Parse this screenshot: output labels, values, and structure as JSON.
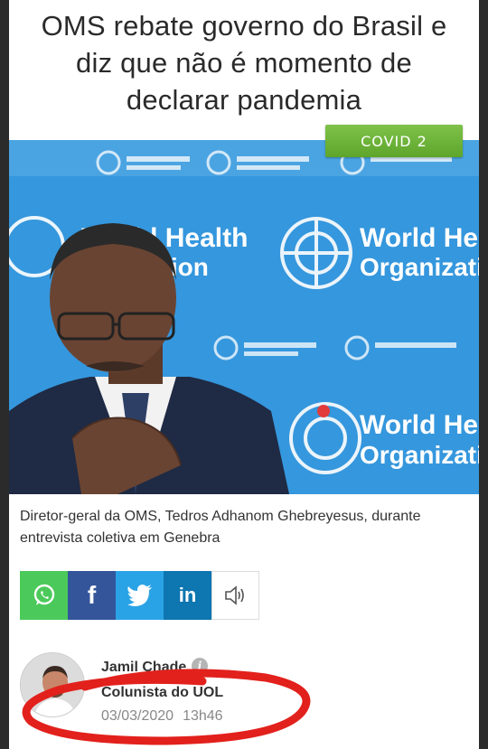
{
  "article": {
    "headline_lines": [
      "OMS rebate governo do Brasil e",
      "diz que não é momento de",
      "declarar pandemia"
    ],
    "tag": "COVID 2",
    "photo_backdrop_text": [
      "World Health",
      "Organization"
    ],
    "caption": "Diretor-geral da OMS, Tedros Adhanom Ghebreyesus, durante entrevista coletiva em Genebra"
  },
  "share": {
    "buttons": [
      {
        "name": "whatsapp",
        "icon": "whatsapp-icon"
      },
      {
        "name": "facebook",
        "icon": "facebook-icon",
        "glyph": "f"
      },
      {
        "name": "twitter",
        "icon": "twitter-icon"
      },
      {
        "name": "linkedin",
        "icon": "linkedin-icon",
        "glyph": "in"
      },
      {
        "name": "audio",
        "icon": "speaker-icon"
      }
    ]
  },
  "author": {
    "name": "Jamil Chade",
    "info_glyph": "i",
    "role": "Colunista do UOL",
    "date": "03/03/2020",
    "time": "13h46"
  },
  "colors": {
    "tag_green": "#6cb23a",
    "whatsapp": "#4bc95a",
    "facebook": "#34559a",
    "twitter": "#2aa3e6",
    "linkedin": "#0e76b0",
    "annotation_red": "#e2211c"
  }
}
